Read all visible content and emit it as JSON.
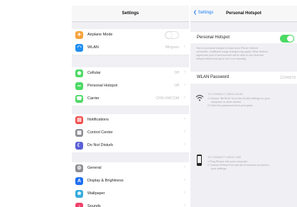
{
  "settings": {
    "title": "Settings",
    "group1": [
      {
        "label": "Airplane Mode",
        "icon": "airplane-icon",
        "color": "#f6a33a",
        "glyph": "✈"
      },
      {
        "label": "WLAN",
        "icon": "wifi-icon",
        "color": "#1f8ef1",
        "glyph": "◠",
        "value": "Mingooo"
      }
    ],
    "group2": [
      {
        "label": "Cellular",
        "icon": "cellular-icon",
        "color": "#4cd964",
        "glyph": "◉",
        "value": "Off"
      },
      {
        "label": "Personal Hotspot",
        "icon": "hotspot-icon",
        "color": "#4cd964",
        "glyph": "∞",
        "value": "Off"
      },
      {
        "label": "Carrier",
        "icon": "phone-icon",
        "color": "#4cd964",
        "glyph": "☎",
        "value": "CHN-UNICOM"
      }
    ],
    "group3": [
      {
        "label": "Notifications",
        "icon": "notifications-icon",
        "color": "#f14d4d",
        "glyph": "▤"
      },
      {
        "label": "Control Center",
        "icon": "control-center-icon",
        "color": "#8e8e93",
        "glyph": "▦"
      },
      {
        "label": "Do Not Disturb",
        "icon": "moon-icon",
        "color": "#5b5fd6",
        "glyph": "☾"
      }
    ],
    "group4": [
      {
        "label": "General",
        "icon": "gear-icon",
        "color": "#8e8e93",
        "glyph": "⚙"
      },
      {
        "label": "Display & Brightness",
        "icon": "display-icon",
        "color": "#1f6ff1",
        "glyph": "A"
      },
      {
        "label": "Wallpaper",
        "icon": "wallpaper-icon",
        "color": "#35aadc",
        "glyph": "❀"
      },
      {
        "label": "Sounds",
        "icon": "sounds-icon",
        "color": "#f1416c",
        "glyph": "♪"
      }
    ]
  },
  "hotspot": {
    "back_label": "Settings",
    "title": "Personal Hotspot",
    "toggle_label": "Personal Hotspot",
    "toggle_on": true,
    "description": [
      "Turn on personal hotspot to share your iPhone Internet",
      "connection. Additional usage charges may apply. Other devices",
      "signed into your iCloud account will be able to use personal",
      "hotspot without having to turn it on manually."
    ],
    "password_label": "WLAN Password",
    "password_value": "12345678",
    "wlan_section": {
      "title": "TO CONNECT USING WLAN",
      "lines": [
        "1 Choose \"BeTert2\" from the WLAN settings on your",
        "computer or other device.",
        "2 Enter the password when prompted."
      ]
    },
    "usb_section": {
      "title": "TO CONNECT USING USB",
      "lines": [
        "1 Plug iPhone into your computer.",
        "2 Choose iPhone from the list of network services in",
        "your settings."
      ]
    }
  },
  "colors": {
    "accent": "#1a7cf7",
    "toggle_on": "#4cd964",
    "background": "#efeff4"
  }
}
